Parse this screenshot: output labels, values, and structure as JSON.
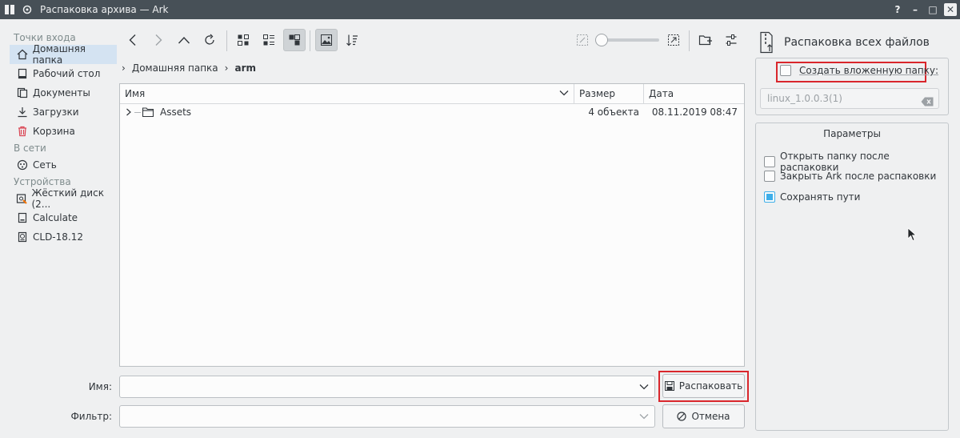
{
  "window": {
    "title": "Распаковка архива — Ark",
    "buttons": [
      "?",
      "–",
      "□",
      "✕"
    ]
  },
  "places": {
    "sections": [
      {
        "title": "Точки входа",
        "items": [
          {
            "label": "Домашняя папка",
            "icon": "home-icon",
            "selected": true
          },
          {
            "label": "Рабочий стол",
            "icon": "desktop-icon"
          },
          {
            "label": "Документы",
            "icon": "documents-icon"
          },
          {
            "label": "Загрузки",
            "icon": "download-icon"
          },
          {
            "label": "Корзина",
            "icon": "trash-icon"
          }
        ]
      },
      {
        "title": "В сети",
        "items": [
          {
            "label": "Сеть",
            "icon": "network-icon"
          }
        ]
      },
      {
        "title": "Устройства",
        "items": [
          {
            "label": "Жёсткий диск (2...",
            "icon": "harddisk-icon"
          },
          {
            "label": "Calculate",
            "icon": "drive-icon"
          },
          {
            "label": "CLD-18.12",
            "icon": "optical-disc-icon"
          }
        ]
      }
    ]
  },
  "breadcrumb": {
    "items": [
      "Домашняя папка",
      "arm"
    ]
  },
  "fileview": {
    "columns": [
      "Имя",
      "Размер",
      "Дата"
    ],
    "rows": [
      {
        "name": "Assets",
        "size": "4 объекта",
        "date": "08.11.2019 08:47",
        "icon": "folder-icon"
      }
    ]
  },
  "form": {
    "name_label": "Имя:",
    "name_value": "",
    "filter_label": "Фильтр:",
    "filter_value": "",
    "extract_button": "Распаковать",
    "cancel_button": "Отмена"
  },
  "rpanel": {
    "title": "Распаковка всех файлов",
    "create_subfolder_label": "Создать вложенную папку:",
    "create_subfolder_checked": false,
    "subfolder_name": "linux_1.0.0.3(1)",
    "options_title": "Параметры",
    "options": [
      {
        "label": "Открыть папку после распаковки",
        "checked": false
      },
      {
        "label": "Закрыть Ark после распаковки",
        "checked": false
      },
      {
        "label": "Сохранять пути",
        "checked": true
      }
    ]
  },
  "colors": {
    "accent": "#3daee9",
    "highlight_frame": "#d9262c",
    "titlebar": "#475057"
  }
}
